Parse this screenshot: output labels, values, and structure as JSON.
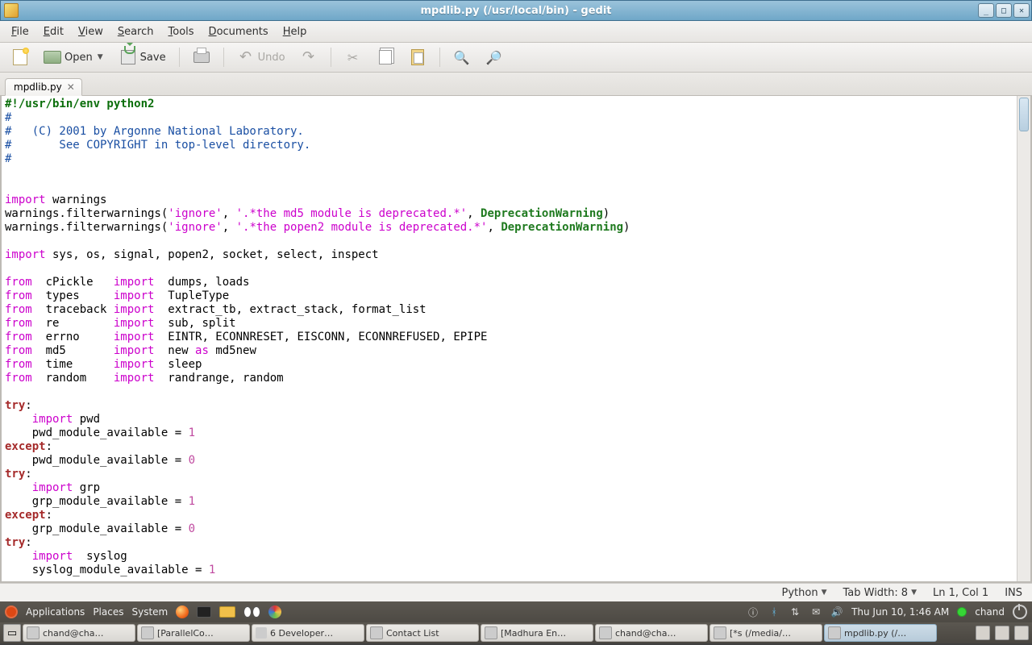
{
  "window": {
    "title": "mpdlib.py (/usr/local/bin) - gedit"
  },
  "menu": {
    "file": "File",
    "edit": "Edit",
    "view": "View",
    "search": "Search",
    "tools": "Tools",
    "documents": "Documents",
    "help": "Help"
  },
  "toolbar": {
    "open": "Open",
    "save": "Save",
    "undo": "Undo"
  },
  "tab": {
    "filename": "mpdlib.py"
  },
  "code": {
    "l1_shebang": "#!/usr/bin/env python2",
    "l2": "#",
    "l3": "#   (C) 2001 by Argonne National Laboratory.",
    "l4": "#       See COPYRIGHT in top-level directory.",
    "l5": "#",
    "import_kw": "import",
    "from_kw": "from",
    "as_kw": "as",
    "try_kw": "try",
    "except_kw": "except",
    "warnings": " warnings",
    "fw_call1a": "warnings.filterwarnings(",
    "fw_call1b": "'ignore'",
    "fw_call1c": ", ",
    "fw_call1d": "'.*the md5 module is deprecated.*'",
    "fw_call1e": ", ",
    "fw_call1f": "DeprecationWarning",
    "fw_call1g": ")",
    "fw_call2d": "'.*the popen2 module is deprecated.*'",
    "imp_line": " sys, os, signal, popen2, socket, select, inspect",
    "f_cpickle_mod": "  cPickle   ",
    "f_cpickle_imp": "  dumps, loads",
    "f_types_mod": "  types     ",
    "f_types_imp": "  TupleType",
    "f_tb_mod": "  traceback ",
    "f_tb_imp": "  extract_tb, extract_stack, format_list",
    "f_re_mod": "  re        ",
    "f_re_imp": "  sub, split",
    "f_errno_mod": "  errno     ",
    "f_errno_imp": "  EINTR, ECONNRESET, EISCONN, ECONNREFUSED, EPIPE",
    "f_md5_mod": "  md5       ",
    "f_md5_imp_a": "  new ",
    "f_md5_imp_b": " md5new",
    "f_time_mod": "  time      ",
    "f_time_imp": "  sleep",
    "f_random_mod": "  random    ",
    "f_random_imp": "  randrange, random",
    "colon": ":",
    "indent": "    ",
    "imp_pwd": " pwd",
    "pwd_avail": "    pwd_module_available = ",
    "imp_grp": " grp",
    "grp_avail": "    grp_module_available = ",
    "imp_syslog": "  syslog",
    "syslog_avail": "    syslog_module_available = ",
    "one": "1",
    "zero": "0"
  },
  "status": {
    "language": "Python",
    "tabwidth_label": "Tab Width: ",
    "tabwidth_value": "8",
    "cursor": "Ln 1, Col 1",
    "insmode": "INS"
  },
  "panel_top": {
    "applications": "Applications",
    "places": "Places",
    "system": "System",
    "clock": "Thu Jun 10,  1:46 AM",
    "user": "chand"
  },
  "tasks": [
    "chand@cha…",
    "[ParallelCo…",
    "6 Developer…",
    "Contact List",
    "[Madhura En…",
    "chand@cha…",
    "[*s (/media/…",
    "mpdlib.py (/…"
  ]
}
